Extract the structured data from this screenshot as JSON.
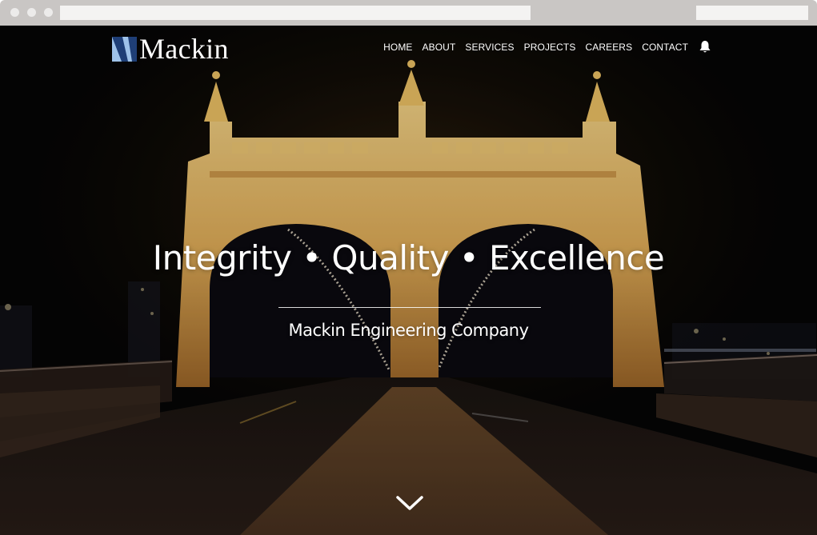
{
  "browser": {
    "url": "",
    "search": ""
  },
  "header": {
    "logo_text": "Mackin",
    "logo_icon": "mackin-logo-mark",
    "nav": [
      {
        "label": "HOME"
      },
      {
        "label": "ABOUT"
      },
      {
        "label": "SERVICES"
      },
      {
        "label": "PROJECTS"
      },
      {
        "label": "CAREERS"
      },
      {
        "label": "CONTACT"
      }
    ],
    "notification_icon": "bell-icon"
  },
  "hero": {
    "headline": "Integrity • Quality • Excellence",
    "subtitle": "Mackin Engineering Company",
    "scroll_icon": "chevron-down-icon"
  },
  "colors": {
    "text": "#ffffff",
    "logo_blue_dark": "#1f3f77",
    "logo_blue_light": "#9fc3ea",
    "bridge_glow": "#f3c06a",
    "night_sky": "#060606"
  }
}
